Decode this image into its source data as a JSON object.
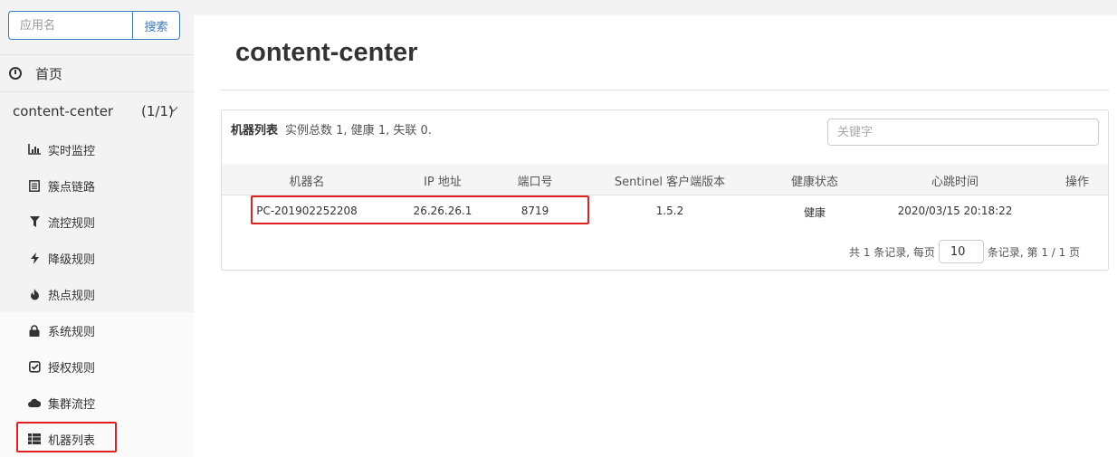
{
  "sidebar": {
    "search_placeholder": "应用名",
    "search_button": "搜索",
    "home_label": "首页",
    "app": {
      "name": "content-center",
      "count": "(1/1)"
    },
    "menu": [
      {
        "label": "实时监控",
        "icon": "bar-chart-icon"
      },
      {
        "label": "簇点链路",
        "icon": "list-icon"
      },
      {
        "label": "流控规则",
        "icon": "filter-icon"
      },
      {
        "label": "降级规则",
        "icon": "flash-icon"
      },
      {
        "label": "热点规则",
        "icon": "fire-icon"
      },
      {
        "label": "系统规则",
        "icon": "lock-icon"
      },
      {
        "label": "授权规则",
        "icon": "check-square-icon"
      },
      {
        "label": "集群流控",
        "icon": "cloud-icon"
      },
      {
        "label": "机器列表",
        "icon": "th-list-icon"
      }
    ]
  },
  "main": {
    "title": "content-center",
    "panel": {
      "heading": "机器列表",
      "summary": "实例总数 1, 健康 1, 失联 0.",
      "keyword_placeholder": "关键字",
      "columns": [
        "机器名",
        "IP 地址",
        "端口号",
        "Sentinel 客户端版本",
        "健康状态",
        "心跳时间",
        "操作"
      ],
      "rows": [
        [
          "PC-201902252208",
          "26.26.26.1",
          "8719",
          "1.5.2",
          "健康",
          "2020/03/15 20:18:22",
          ""
        ]
      ],
      "pager": {
        "prefix": "共 1 条记录, 每页",
        "page_size": "10",
        "suffix": "条记录, 第 1 / 1 页"
      }
    }
  },
  "colors": {
    "accent": "#3a7bbf",
    "highlight": "#e02020",
    "sidebar_bg": "#f3f3f4"
  }
}
